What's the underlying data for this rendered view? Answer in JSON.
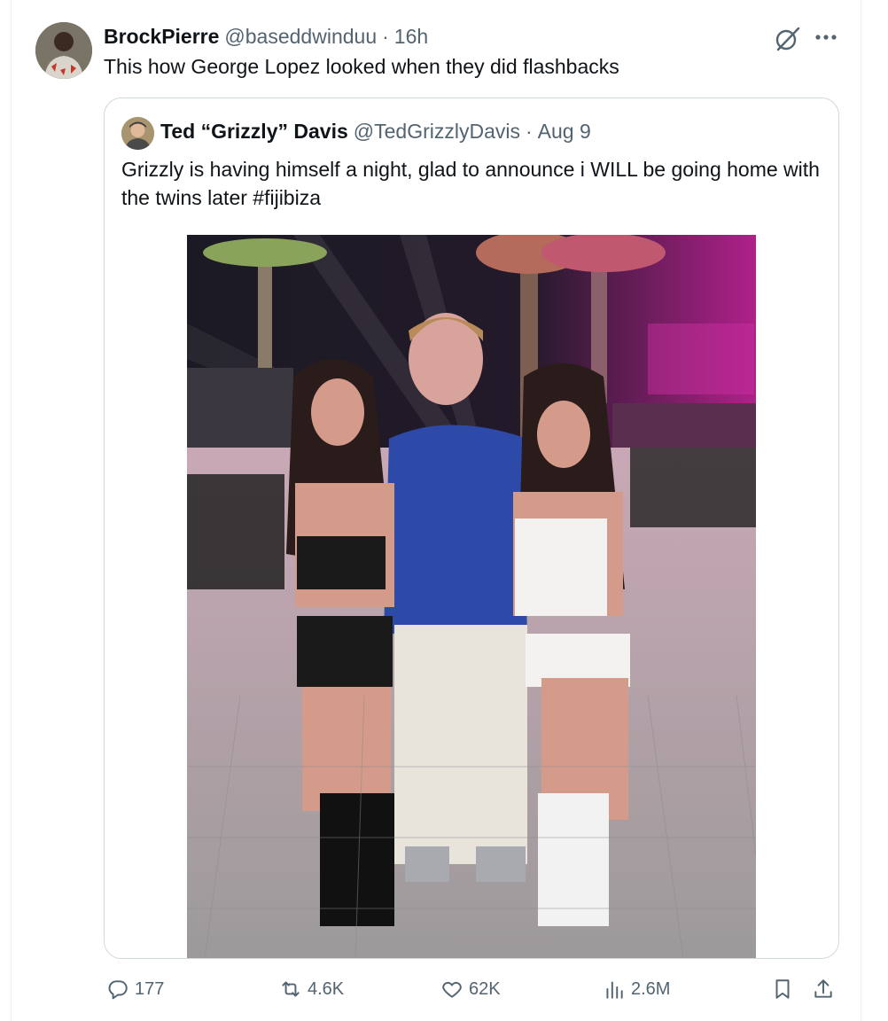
{
  "tweet": {
    "author_name": "BrockPierre",
    "author_handle": "@baseddwinduu",
    "separator": "·",
    "time": "16h",
    "text": "This how George Lopez looked when they did flashbacks"
  },
  "quoted_tweet": {
    "author_name": "Ted “Grizzly” Davis",
    "author_handle": "@TedGrizzlyDavis",
    "separator": "·",
    "date": "Aug 9",
    "text": "Grizzly is having himself a night, glad to announce i WILL be going home with the twins later #fijibiza"
  },
  "actions": {
    "replies": "177",
    "reposts": "4.6K",
    "likes": "62K",
    "views": "2.6M"
  },
  "icons": {
    "grok": "grok-icon",
    "more": "more-icon",
    "reply": "reply-icon",
    "retweet": "retweet-icon",
    "like": "heart-icon",
    "views": "views-icon",
    "bookmark": "bookmark-icon",
    "share": "share-icon"
  },
  "colors": {
    "text_primary": "#0f1419",
    "text_secondary": "#536471",
    "border": "#cfd9de"
  }
}
